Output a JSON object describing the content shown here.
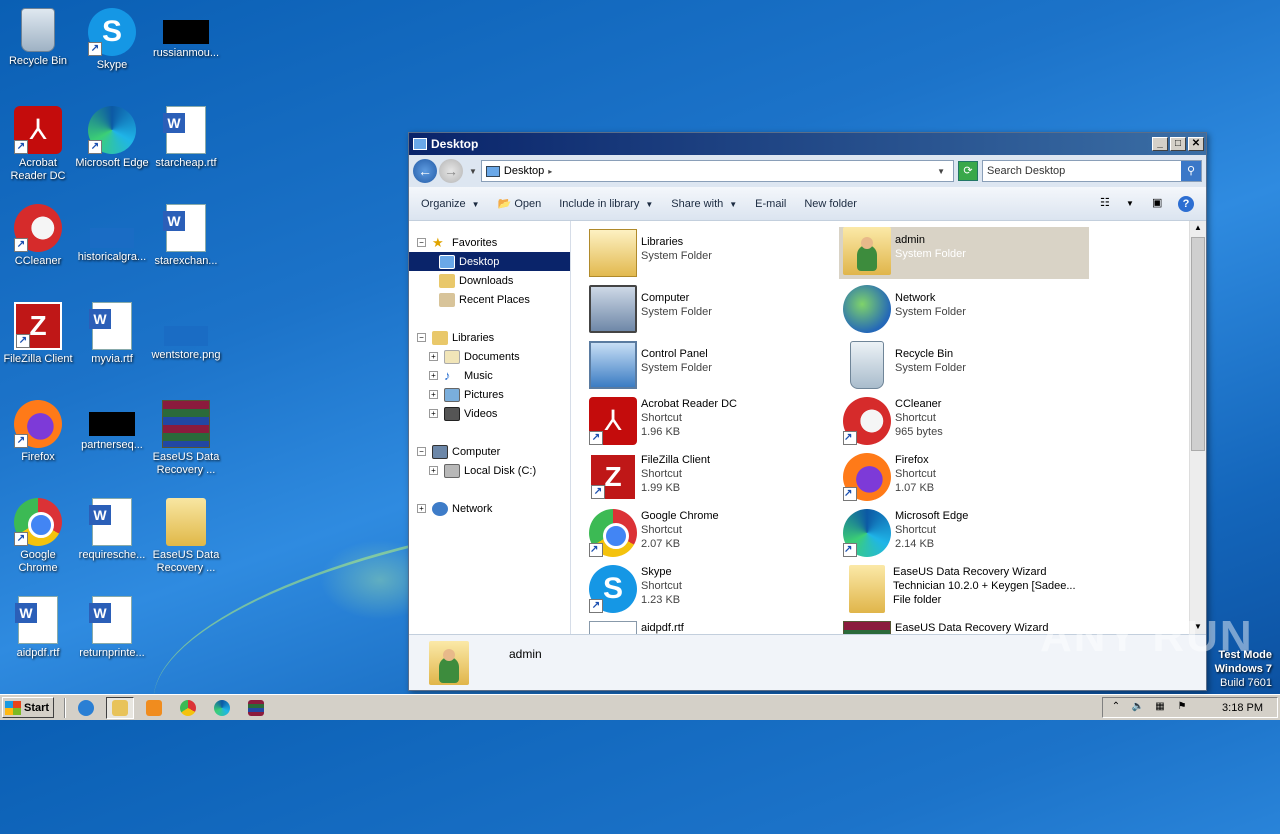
{
  "desktop": {
    "icons": [
      {
        "label": "Recycle Bin"
      },
      {
        "label": "Skype"
      },
      {
        "label": "russianmou..."
      },
      {
        "label": "Acrobat Reader DC"
      },
      {
        "label": "Microsoft Edge"
      },
      {
        "label": "starcheap.rtf"
      },
      {
        "label": "CCleaner"
      },
      {
        "label": "historicalgra..."
      },
      {
        "label": "starexchan..."
      },
      {
        "label": "FileZilla Client"
      },
      {
        "label": "myvia.rtf"
      },
      {
        "label": "wentstore.png"
      },
      {
        "label": "Firefox"
      },
      {
        "label": "partnerseq..."
      },
      {
        "label": "EaseUS Data Recovery ..."
      },
      {
        "label": "Google Chrome"
      },
      {
        "label": "requiresche..."
      },
      {
        "label": "EaseUS Data Recovery ..."
      },
      {
        "label": "aidpdf.rtf"
      },
      {
        "label": "returnprinte..."
      }
    ]
  },
  "window": {
    "title": "Desktop",
    "address": "Desktop",
    "search_placeholder": "Search Desktop",
    "toolbar": {
      "organize": "Organize",
      "open": "Open",
      "include": "Include in library",
      "share": "Share with",
      "email": "E-mail",
      "new_folder": "New folder"
    },
    "nav": {
      "favorites": "Favorites",
      "desktop": "Desktop",
      "downloads": "Downloads",
      "recent": "Recent Places",
      "libraries": "Libraries",
      "documents": "Documents",
      "music": "Music",
      "pictures": "Pictures",
      "videos": "Videos",
      "computer": "Computer",
      "local_disk": "Local Disk (C:)",
      "network": "Network"
    },
    "items": [
      {
        "name": "Libraries",
        "l2": "System Folder",
        "l3": ""
      },
      {
        "name": "admin",
        "l2": "System Folder",
        "l3": ""
      },
      {
        "name": "Computer",
        "l2": "System Folder",
        "l3": ""
      },
      {
        "name": "Network",
        "l2": "System Folder",
        "l3": ""
      },
      {
        "name": "Control Panel",
        "l2": "System Folder",
        "l3": ""
      },
      {
        "name": "Recycle Bin",
        "l2": "System Folder",
        "l3": ""
      },
      {
        "name": "Acrobat Reader DC",
        "l2": "Shortcut",
        "l3": "1.96 KB"
      },
      {
        "name": "CCleaner",
        "l2": "Shortcut",
        "l3": "965 bytes"
      },
      {
        "name": "FileZilla Client",
        "l2": "Shortcut",
        "l3": "1.99 KB"
      },
      {
        "name": "Firefox",
        "l2": "Shortcut",
        "l3": "1.07 KB"
      },
      {
        "name": "Google Chrome",
        "l2": "Shortcut",
        "l3": "2.07 KB"
      },
      {
        "name": "Microsoft Edge",
        "l2": "Shortcut",
        "l3": "2.14 KB"
      },
      {
        "name": "Skype",
        "l2": "Shortcut",
        "l3": "1.23 KB"
      },
      {
        "name": "EaseUS Data Recovery Wizard",
        "l2": "Technician 10.2.0 + Keygen [Sadee...",
        "l3": "File folder"
      },
      {
        "name": "aidpdf.rtf",
        "l2": "",
        "l3": ""
      },
      {
        "name": "EaseUS Data Recovery Wizard",
        "l2": "",
        "l3": ""
      }
    ],
    "details_name": "admin"
  },
  "taskbar": {
    "start": "Start",
    "clock": "3:18 PM"
  },
  "watermark": {
    "line1": "Test Mode",
    "line2": "Windows 7",
    "line3": "Build 7601",
    "brand": "ANY RUN"
  }
}
